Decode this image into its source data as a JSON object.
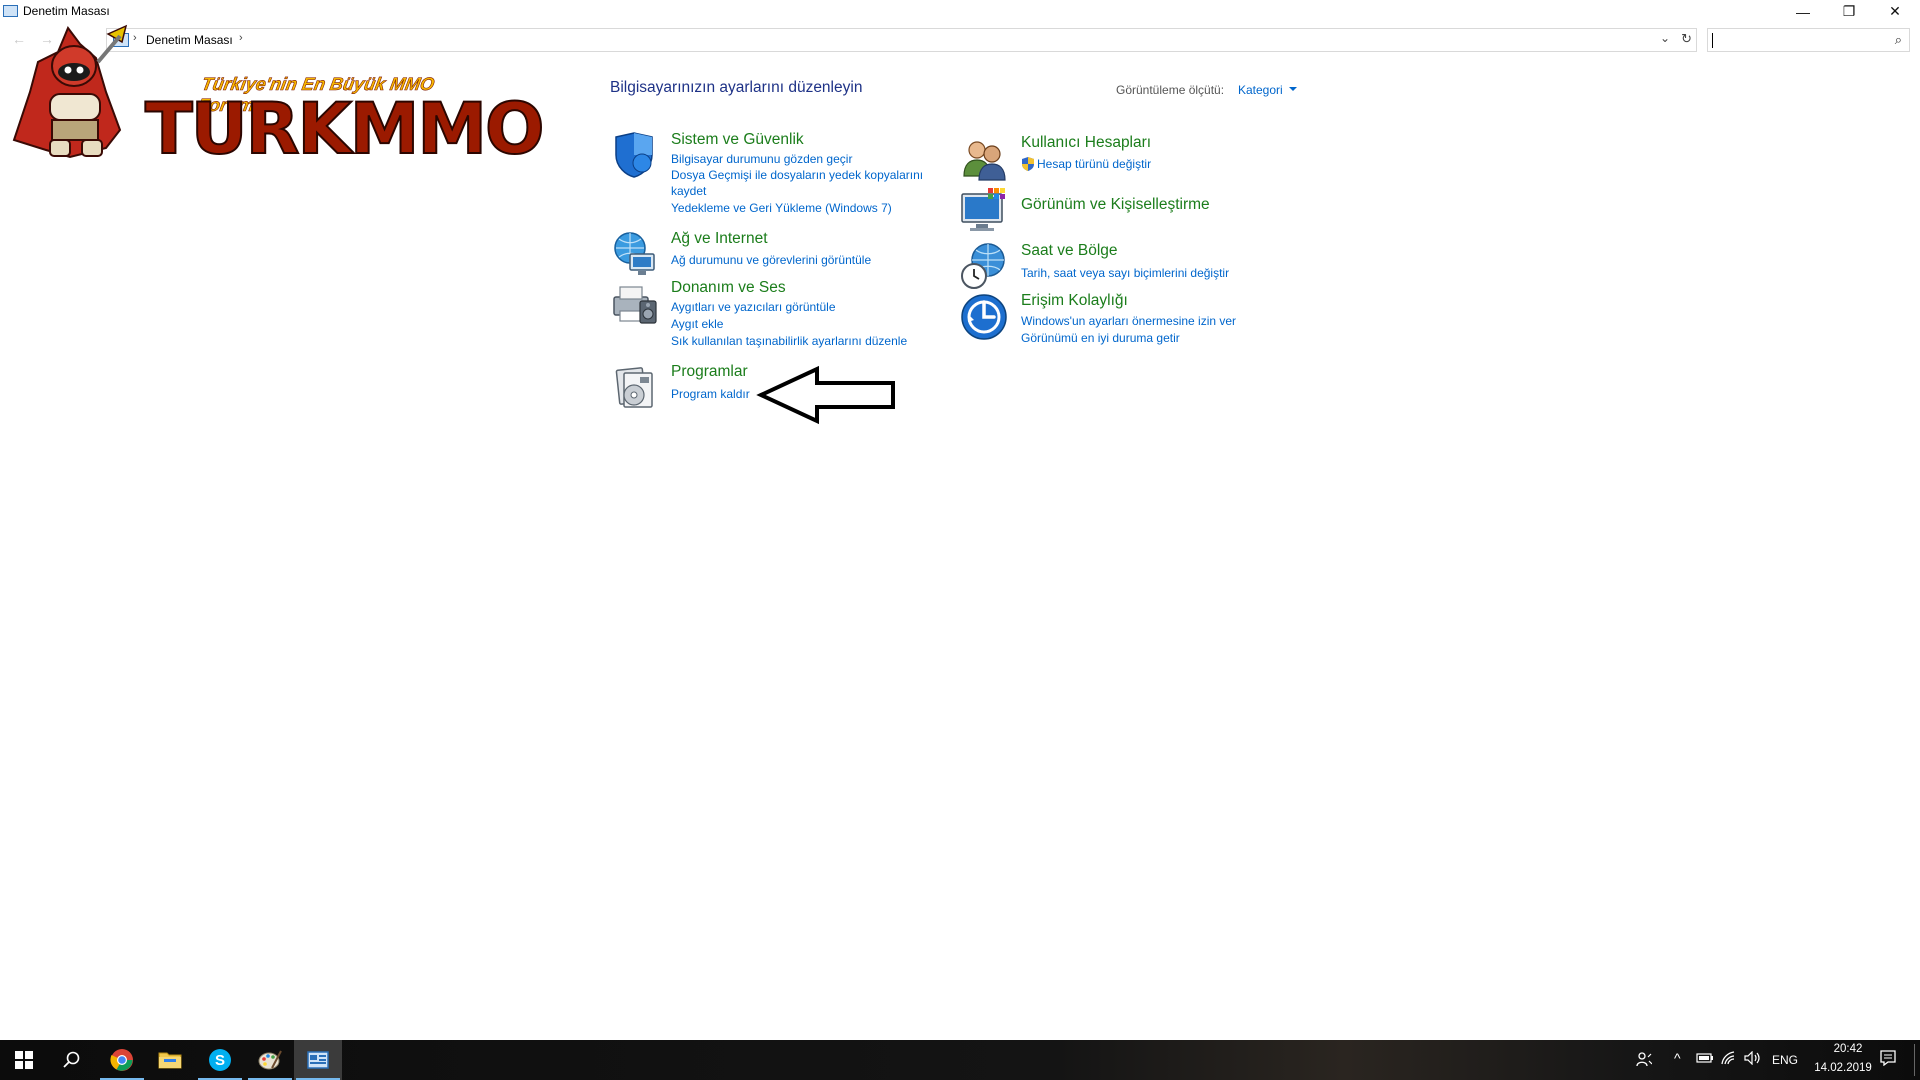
{
  "window": {
    "title": "Denetim Masası",
    "controls": {
      "minimize": "—",
      "restore": "❐",
      "close": "✕"
    }
  },
  "address_bar": {
    "crumb": "Denetim Masası",
    "separator": "›",
    "search_placeholder": ""
  },
  "watermark": {
    "tagline": "Türkiye'nin En Büyük MMO Forumu",
    "brand": "TURKMMO"
  },
  "main": {
    "heading": "Bilgisayarınızın ayarlarını düzenleyin",
    "view_by_label": "Görüntüleme ölçütü:",
    "view_by_value": "Kategori"
  },
  "categories_left": [
    {
      "title": "Sistem ve Güvenlik",
      "icon": "shield-icon",
      "links": [
        "Bilgisayar durumunu gözden geçir",
        "Dosya Geçmişi ile dosyaların yedek kopyalarını",
        "kaydet",
        "Yedekleme ve Geri Yükleme (Windows 7)"
      ]
    },
    {
      "title": "Ağ ve Internet",
      "icon": "network-globe-icon",
      "links": [
        "Ağ durumunu ve görevlerini görüntüle"
      ]
    },
    {
      "title": "Donanım ve Ses",
      "icon": "printer-speaker-icon",
      "links": [
        "Aygıtları ve yazıcıları görüntüle",
        "Aygıt ekle",
        "Sık kullanılan taşınabilirlik ayarlarını düzenle"
      ]
    },
    {
      "title": "Programlar",
      "icon": "programs-disc-icon",
      "links": [
        "Program kaldır"
      ]
    }
  ],
  "categories_right": [
    {
      "title": "Kullanıcı Hesapları",
      "icon": "users-icon",
      "links": [
        "Hesap türünü değiştir"
      ]
    },
    {
      "title": "Görünüm ve Kişiselleştirme",
      "icon": "monitor-palette-icon",
      "links": []
    },
    {
      "title": "Saat ve Bölge",
      "icon": "clock-globe-icon",
      "links": [
        "Tarih, saat veya sayı biçimlerini değiştir"
      ]
    },
    {
      "title": "Erişim Kolaylığı",
      "icon": "accessibility-icon",
      "links": [
        "Windows'un ayarları önermesine izin ver",
        "Görünümü en iyi duruma getir"
      ]
    }
  ],
  "taskbar": {
    "apps": [
      "start-icon",
      "search-icon",
      "chrome-icon",
      "file-explorer-icon",
      "skype-icon",
      "paint-icon",
      "control-panel-icon"
    ],
    "language": "ENG",
    "time": "20:42",
    "date": "14.02.2019"
  },
  "colors": {
    "category_title": "#1b7d1b",
    "link": "#0066cc",
    "heading": "#1e3287"
  }
}
